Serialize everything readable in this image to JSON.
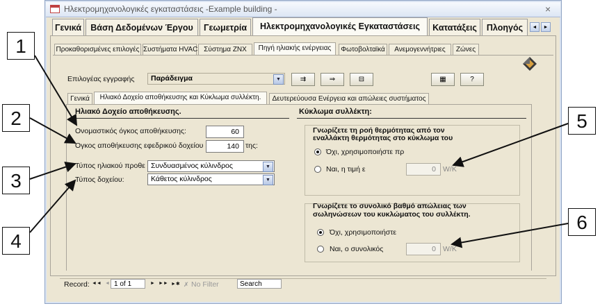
{
  "window": {
    "title": "Ηλεκτρομηχανολογικές εγκαταστάσεις -Example building -",
    "close": "×"
  },
  "main_tabs": [
    "Γενικά",
    "Βάση Δεδομένων Έργου",
    "Γεωμετρία",
    "Ηλεκτρομηχανολογικές Εγκαταστάσεις",
    "Κατατάξεις",
    "Πλοηγός"
  ],
  "main_tab_nav": [
    "◄",
    "►"
  ],
  "sub_tabs": [
    "Προκαθορισμένες επιλογές",
    "Συστήματα HVAC",
    "Σύστημα ΖΝΧ",
    "Πηγή ηλιακής ενέργειας",
    "Φωτοβολταϊκά",
    "Ανεμογεννήτριες",
    "Ζώνες"
  ],
  "record_selector": {
    "label": "Επιλογέας εγγραφής",
    "value": "Παράδειγμα"
  },
  "toolbar": {
    "b1": "⇉",
    "b2": "⇒",
    "b3": "⊟",
    "b4": "▦",
    "b5": "?"
  },
  "inner_tabs": [
    "Γενικά",
    "Ηλιακό Δοχείο αποθήκευσης και Κύκλωμα συλλέκτη.",
    "Δευτερεύουσα Ενέργεια και απώλειες συστήματος"
  ],
  "left_section": {
    "title": "Ηλιακό Δοχείο αποθήκευσης.",
    "nominal_label": "Ονομαστικός όγκος αποθήκευσης:",
    "nominal_value": "60",
    "aux_label": "Όγκος αποθήκευσης εφεδρικού δοχείου",
    "aux_value": "140",
    "aux_suffix": "της:",
    "collector_type_label": "Τύπος ηλιακού προθε",
    "collector_type_value": "Συνδυασμένος κύλινδρος",
    "tank_type_label": "Τύπος δοχείου:",
    "tank_type_value": "Κάθετος κύλινδρος"
  },
  "right_section": {
    "title": "Κύκλωμα συλλέκτη:",
    "group1_title_l1": "Γνωρίζετε τη ροή θερμότητας από τον",
    "group1_title_l2": "εναλλάκτη θερμότητας στο κύκλωμα του",
    "g1_opt1": "Όχι, χρησιμοποιήστε πρ",
    "g1_opt2": "Ναι, η τιμή ε",
    "g1_value": "0",
    "g1_unit": "W/K",
    "group2_title_l1": "Γνωρίζετε το συνολικό βαθμό απώλειας των",
    "group2_title_l2": "σωληνώσεων του κυκλώματος του συλλέκτη.",
    "g2_opt1": "Όχι, χρησιμοποιήστε",
    "g2_opt2": "Ναι, ο συνολικός",
    "g2_value": "0",
    "g2_unit": "W/K"
  },
  "record_nav": {
    "label": "Record:",
    "first": "◄◄",
    "prev": "◄",
    "position": "1 of 1",
    "next": "►",
    "last": "►►",
    "new": "►✱",
    "filter": "No Filter",
    "search": "Search"
  },
  "callouts": [
    "1",
    "2",
    "3",
    "4",
    "5",
    "6"
  ]
}
